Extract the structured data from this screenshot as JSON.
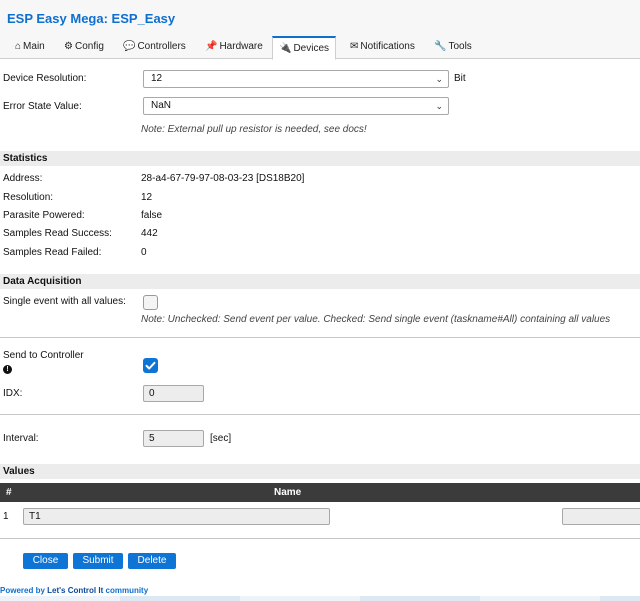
{
  "app": {
    "title": "ESP Easy Mega: ESP_Easy"
  },
  "tabs": [
    {
      "label": "Main",
      "icon": "home-icon"
    },
    {
      "label": "Config",
      "icon": "gear-icon"
    },
    {
      "label": "Controllers",
      "icon": "chat-icon"
    },
    {
      "label": "Hardware",
      "icon": "pin-icon"
    },
    {
      "label": "Devices",
      "icon": "plug-icon",
      "active": true
    },
    {
      "label": "Notifications",
      "icon": "mail-icon"
    },
    {
      "label": "Tools",
      "icon": "wrench-icon"
    }
  ],
  "settings": {
    "resolution_label": "Device Resolution:",
    "resolution_value": "12",
    "resolution_unit": "Bit",
    "error_label": "Error State Value:",
    "error_value": "NaN",
    "note": "Note: External pull up resistor is needed, see docs!"
  },
  "statistics": {
    "title": "Statistics",
    "rows": [
      {
        "label": "Address:",
        "value": "28-a4-67-79-97-08-03-23 [DS18B20]"
      },
      {
        "label": "Resolution:",
        "value": "12"
      },
      {
        "label": "Parasite Powered:",
        "value": "false"
      },
      {
        "label": "Samples Read Success:",
        "value": "442"
      },
      {
        "label": "Samples Read Failed:",
        "value": "0"
      }
    ]
  },
  "acquisition": {
    "title": "Data Acquisition",
    "single_event_label": "Single event with all values:",
    "single_event_checked": false,
    "single_event_note": "Note: Unchecked: Send event per value. Checked: Send single event (taskname#All) containing all values",
    "send_label": "Send to Controller",
    "send_checked": true,
    "idx_label": "IDX:",
    "idx_value": "0",
    "interval_label": "Interval:",
    "interval_value": "5",
    "interval_unit": "[sec]"
  },
  "values": {
    "title": "Values",
    "col_num": "#",
    "col_name": "Name",
    "rows": [
      {
        "num": "1",
        "name": "T1"
      }
    ]
  },
  "buttons": {
    "close": "Close",
    "submit": "Submit",
    "delete": "Delete"
  },
  "footer": {
    "prefix": "Powered by",
    "link": "Let's Control It",
    "suffix": "community"
  },
  "colors": {
    "accent": "#0e74d6",
    "title": "#0e6fcf",
    "table_header": "#3b3b3b",
    "section_bg": "#ececec"
  }
}
